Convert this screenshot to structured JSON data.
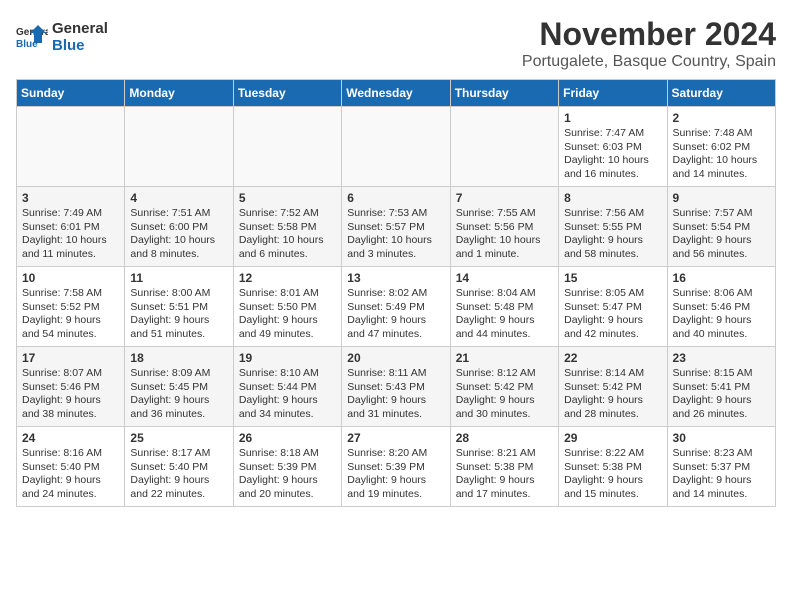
{
  "logo": {
    "line1": "General",
    "line2": "Blue"
  },
  "title": "November 2024",
  "subtitle": "Portugalete, Basque Country, Spain",
  "days_of_week": [
    "Sunday",
    "Monday",
    "Tuesday",
    "Wednesday",
    "Thursday",
    "Friday",
    "Saturday"
  ],
  "weeks": [
    [
      {
        "day": "",
        "content": ""
      },
      {
        "day": "",
        "content": ""
      },
      {
        "day": "",
        "content": ""
      },
      {
        "day": "",
        "content": ""
      },
      {
        "day": "",
        "content": ""
      },
      {
        "day": "1",
        "content": "Sunrise: 7:47 AM\nSunset: 6:03 PM\nDaylight: 10 hours\nand 16 minutes."
      },
      {
        "day": "2",
        "content": "Sunrise: 7:48 AM\nSunset: 6:02 PM\nDaylight: 10 hours\nand 14 minutes."
      }
    ],
    [
      {
        "day": "3",
        "content": "Sunrise: 7:49 AM\nSunset: 6:01 PM\nDaylight: 10 hours\nand 11 minutes."
      },
      {
        "day": "4",
        "content": "Sunrise: 7:51 AM\nSunset: 6:00 PM\nDaylight: 10 hours\nand 8 minutes."
      },
      {
        "day": "5",
        "content": "Sunrise: 7:52 AM\nSunset: 5:58 PM\nDaylight: 10 hours\nand 6 minutes."
      },
      {
        "day": "6",
        "content": "Sunrise: 7:53 AM\nSunset: 5:57 PM\nDaylight: 10 hours\nand 3 minutes."
      },
      {
        "day": "7",
        "content": "Sunrise: 7:55 AM\nSunset: 5:56 PM\nDaylight: 10 hours\nand 1 minute."
      },
      {
        "day": "8",
        "content": "Sunrise: 7:56 AM\nSunset: 5:55 PM\nDaylight: 9 hours\nand 58 minutes."
      },
      {
        "day": "9",
        "content": "Sunrise: 7:57 AM\nSunset: 5:54 PM\nDaylight: 9 hours\nand 56 minutes."
      }
    ],
    [
      {
        "day": "10",
        "content": "Sunrise: 7:58 AM\nSunset: 5:52 PM\nDaylight: 9 hours\nand 54 minutes."
      },
      {
        "day": "11",
        "content": "Sunrise: 8:00 AM\nSunset: 5:51 PM\nDaylight: 9 hours\nand 51 minutes."
      },
      {
        "day": "12",
        "content": "Sunrise: 8:01 AM\nSunset: 5:50 PM\nDaylight: 9 hours\nand 49 minutes."
      },
      {
        "day": "13",
        "content": "Sunrise: 8:02 AM\nSunset: 5:49 PM\nDaylight: 9 hours\nand 47 minutes."
      },
      {
        "day": "14",
        "content": "Sunrise: 8:04 AM\nSunset: 5:48 PM\nDaylight: 9 hours\nand 44 minutes."
      },
      {
        "day": "15",
        "content": "Sunrise: 8:05 AM\nSunset: 5:47 PM\nDaylight: 9 hours\nand 42 minutes."
      },
      {
        "day": "16",
        "content": "Sunrise: 8:06 AM\nSunset: 5:46 PM\nDaylight: 9 hours\nand 40 minutes."
      }
    ],
    [
      {
        "day": "17",
        "content": "Sunrise: 8:07 AM\nSunset: 5:46 PM\nDaylight: 9 hours\nand 38 minutes."
      },
      {
        "day": "18",
        "content": "Sunrise: 8:09 AM\nSunset: 5:45 PM\nDaylight: 9 hours\nand 36 minutes."
      },
      {
        "day": "19",
        "content": "Sunrise: 8:10 AM\nSunset: 5:44 PM\nDaylight: 9 hours\nand 34 minutes."
      },
      {
        "day": "20",
        "content": "Sunrise: 8:11 AM\nSunset: 5:43 PM\nDaylight: 9 hours\nand 31 minutes."
      },
      {
        "day": "21",
        "content": "Sunrise: 8:12 AM\nSunset: 5:42 PM\nDaylight: 9 hours\nand 30 minutes."
      },
      {
        "day": "22",
        "content": "Sunrise: 8:14 AM\nSunset: 5:42 PM\nDaylight: 9 hours\nand 28 minutes."
      },
      {
        "day": "23",
        "content": "Sunrise: 8:15 AM\nSunset: 5:41 PM\nDaylight: 9 hours\nand 26 minutes."
      }
    ],
    [
      {
        "day": "24",
        "content": "Sunrise: 8:16 AM\nSunset: 5:40 PM\nDaylight: 9 hours\nand 24 minutes."
      },
      {
        "day": "25",
        "content": "Sunrise: 8:17 AM\nSunset: 5:40 PM\nDaylight: 9 hours\nand 22 minutes."
      },
      {
        "day": "26",
        "content": "Sunrise: 8:18 AM\nSunset: 5:39 PM\nDaylight: 9 hours\nand 20 minutes."
      },
      {
        "day": "27",
        "content": "Sunrise: 8:20 AM\nSunset: 5:39 PM\nDaylight: 9 hours\nand 19 minutes."
      },
      {
        "day": "28",
        "content": "Sunrise: 8:21 AM\nSunset: 5:38 PM\nDaylight: 9 hours\nand 17 minutes."
      },
      {
        "day": "29",
        "content": "Sunrise: 8:22 AM\nSunset: 5:38 PM\nDaylight: 9 hours\nand 15 minutes."
      },
      {
        "day": "30",
        "content": "Sunrise: 8:23 AM\nSunset: 5:37 PM\nDaylight: 9 hours\nand 14 minutes."
      }
    ]
  ]
}
